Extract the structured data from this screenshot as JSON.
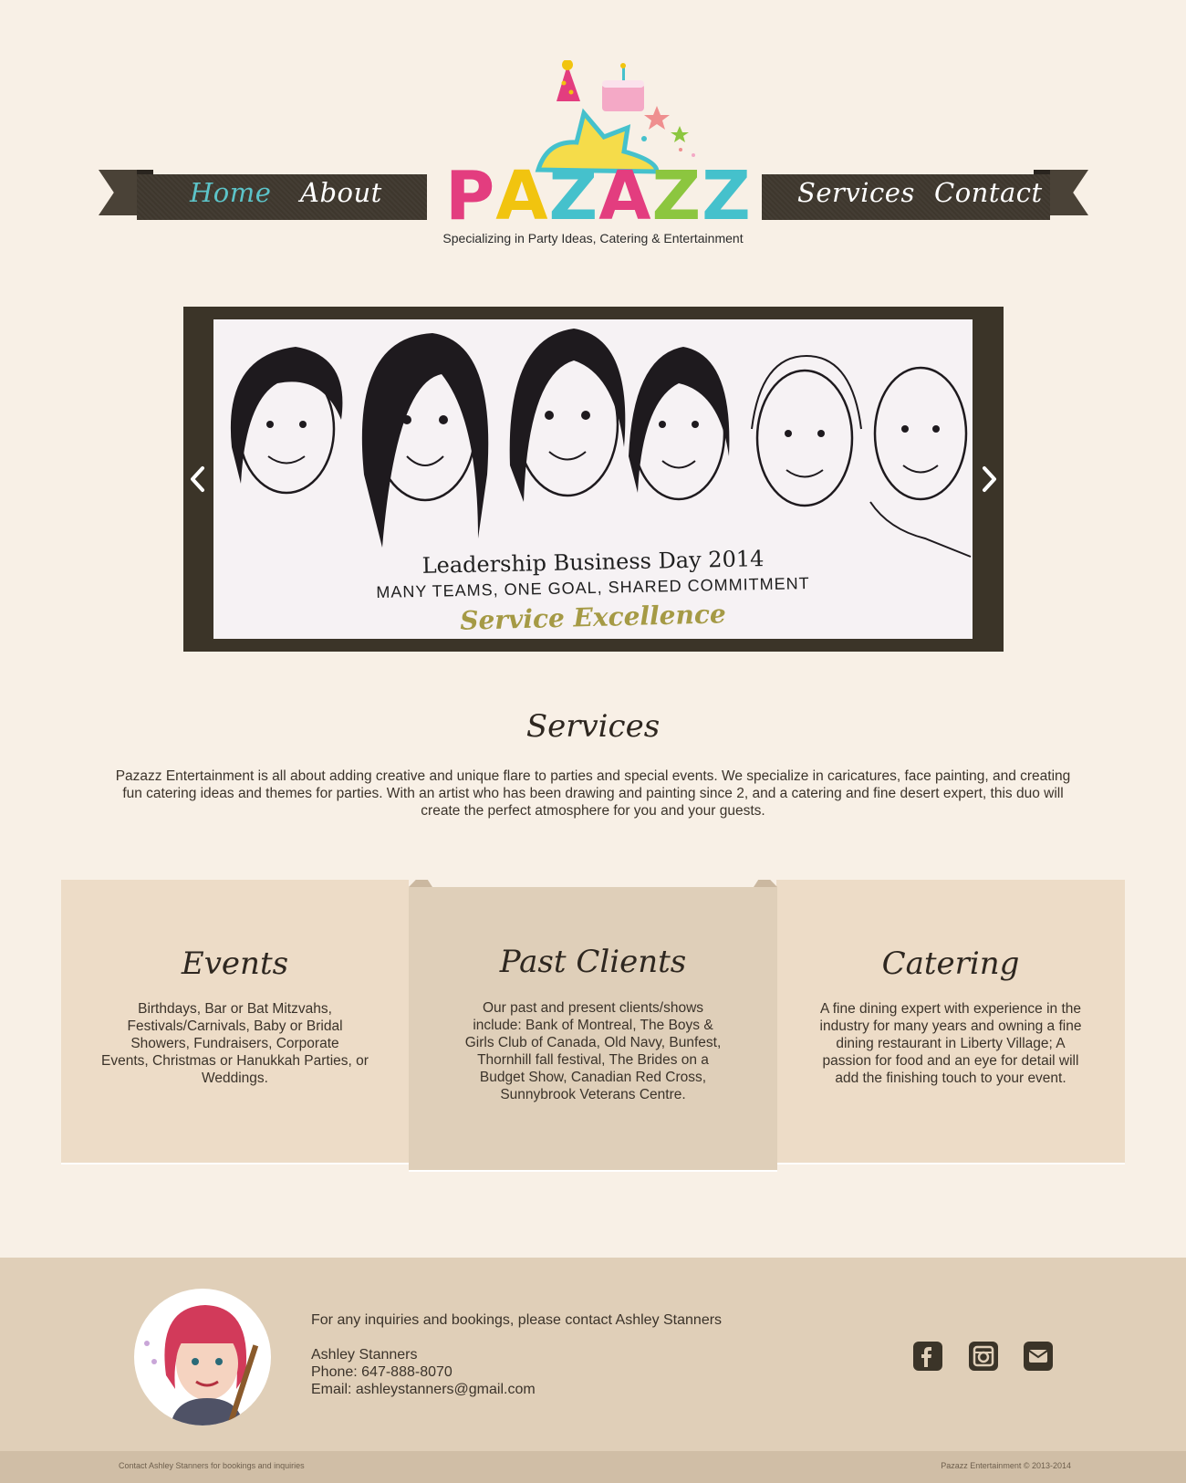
{
  "nav": {
    "left": [
      "Home",
      "About"
    ],
    "right": [
      "Services",
      "Contact"
    ],
    "active": "Home"
  },
  "logo": {
    "letters": [
      "P",
      "A",
      "Z",
      "A",
      "Z",
      "Z"
    ],
    "letter_colors": [
      "#e33d7f",
      "#f1c40f",
      "#45c1cc",
      "#e33d7f",
      "#8cc63f",
      "#45c1cc"
    ],
    "tagline": "Specializing in Party Ideas, Catering & Entertainment"
  },
  "slider": {
    "caption_title": "Leadership Business Day 2014",
    "caption_subtitle": "MANY TEAMS, ONE GOAL, SHARED COMMITMENT",
    "caption_script": "Service Excellence"
  },
  "services": {
    "title": "Services",
    "description": "Pazazz Entertainment is all about adding creative and unique flare to parties and special events. We specialize in caricatures, face painting, and creating fun catering ideas and themes for parties. With an artist who has been drawing and painting since 2, and a catering and fine desert expert, this duo will create the perfect atmosphere for you and your guests."
  },
  "cards": [
    {
      "title": "Events",
      "lines": [
        "Birthdays, Bar or Bat Mitzvahs,",
        "Festivals/Carnivals, Baby or Bridal",
        "Showers, Fundraisers, Corporate",
        "Events, Christmas or Hanukkah Parties, or",
        "Weddings."
      ]
    },
    {
      "title": "Past Clients",
      "lines": [
        "Our past and present clients/shows",
        "include: Bank of Montreal, The Boys &",
        "Girls Club of Canada, Old Navy, Bunfest,",
        "Thornhill fall festival, The Brides on a",
        "Budget Show, Canadian Red Cross,",
        "Sunnybrook Veterans Centre."
      ]
    },
    {
      "title": "Catering",
      "lines": [
        "A fine dining expert with experience in the",
        "industry for many years and owning a fine",
        "dining restaurant in Liberty Village; A",
        "passion for food and an eye for detail will",
        "add the finishing touch to your event."
      ]
    }
  ],
  "footer": {
    "intro": "For any inquiries and bookings, please contact Ashley Stanners",
    "name": "Ashley Stanners",
    "phone": "Phone: 647-888-8070",
    "email": "Email: ashleystanners@gmail.com",
    "social": [
      "facebook-icon",
      "instagram-icon",
      "email-icon"
    ],
    "bottom_left": "Contact Ashley Stanners for bookings and inquiries",
    "bottom_right": "Pazazz Entertainment © 2013-2014"
  }
}
